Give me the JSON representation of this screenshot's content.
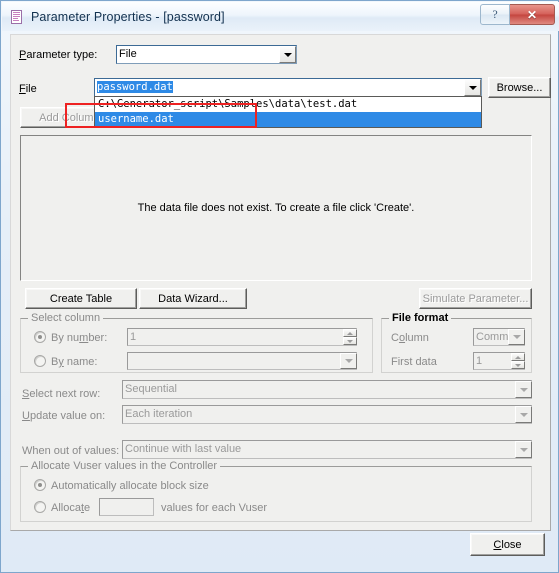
{
  "window": {
    "title": "Parameter Properties - [password]",
    "icon": "document-properties-icon",
    "help_label": "?",
    "close_label": "✕"
  },
  "form": {
    "parameter_type_label": "Parameter type:",
    "parameter_type_value": "File",
    "file_label": "File",
    "file_value": "password.dat",
    "browse_label": "Browse...",
    "add_column_label": "Add Column...",
    "dropdown_open": true,
    "dropdown_items": [
      {
        "label": "C:\\Generator_script\\Samples\\data\\test.dat",
        "selected": false
      },
      {
        "label": "username.dat",
        "selected": true
      }
    ]
  },
  "preview": {
    "message": "The data file does not exist. To create a file click 'Create'."
  },
  "actions": {
    "create_table_label": "Create Table",
    "data_wizard_label": "Data Wizard...",
    "simulate_parameter_label": "Simulate Parameter...",
    "simulate_parameter_enabled": false
  },
  "select_column": {
    "group_label": "Select column",
    "by_number_label": "By number:",
    "by_number_value": "1",
    "by_number_checked": true,
    "by_name_label": "By name:",
    "by_name_value": "",
    "by_name_checked": false
  },
  "file_format": {
    "group_label": "File format",
    "column_label": "Column",
    "column_value": "Comma",
    "first_data_label": "First data",
    "first_data_value": "1"
  },
  "row_options": {
    "select_next_row_label": "Select next row:",
    "select_next_row_value": "Sequential",
    "update_value_on_label": "Update value on:",
    "update_value_on_value": "Each iteration",
    "when_out_of_values_label": "When out of values:",
    "when_out_of_values_value": "Continue with last value"
  },
  "allocate": {
    "group_label": "Allocate Vuser values in the Controller",
    "auto_label": "Automatically allocate block size",
    "auto_checked": true,
    "manual_prefix_label": "Allocate",
    "manual_value": "",
    "manual_suffix_label": "values for each Vuser",
    "manual_checked": false
  },
  "footer": {
    "close_label": "Close"
  },
  "annotation": {
    "highlight_color": "#ee2222",
    "highlight_target": "username.dat"
  }
}
